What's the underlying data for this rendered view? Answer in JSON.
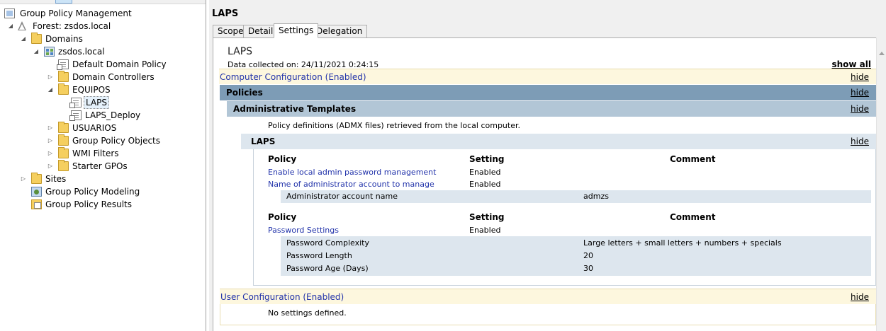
{
  "tree": {
    "nodes": [
      {
        "label": "Group Policy Management",
        "icon": "gpm-console-icon",
        "twisty": ""
      },
      {
        "label": "Forest: zsdos.local",
        "icon": "forest-icon",
        "twisty": "◢"
      },
      {
        "label": "Domains",
        "icon": "folder-icon",
        "twisty": "◢"
      },
      {
        "label": "zsdos.local",
        "icon": "domain-icon",
        "twisty": "◢"
      },
      {
        "label": "Default Domain Policy",
        "icon": "gpo-link-icon",
        "twisty": ""
      },
      {
        "label": "Domain Controllers",
        "icon": "ou-folder-icon",
        "twisty": "▷"
      },
      {
        "label": "EQUIPOS",
        "icon": "ou-folder-icon",
        "twisty": "◢"
      },
      {
        "label": "LAPS",
        "icon": "gpo-link-icon",
        "twisty": ""
      },
      {
        "label": "LAPS_Deploy",
        "icon": "gpo-link-icon",
        "twisty": ""
      },
      {
        "label": "USUARIOS",
        "icon": "ou-folder-icon",
        "twisty": "▷"
      },
      {
        "label": "Group Policy Objects",
        "icon": "folder-icon",
        "twisty": "▷"
      },
      {
        "label": "WMI Filters",
        "icon": "folder-icon",
        "twisty": "▷"
      },
      {
        "label": "Starter GPOs",
        "icon": "folder-icon",
        "twisty": "▷"
      },
      {
        "label": "Sites",
        "icon": "sites-folder-icon",
        "twisty": "▷"
      },
      {
        "label": "Group Policy Modeling",
        "icon": "modeling-icon",
        "twisty": ""
      },
      {
        "label": "Group Policy Results",
        "icon": "results-icon",
        "twisty": ""
      }
    ]
  },
  "main": {
    "title": "LAPS",
    "tabs": [
      "Scope",
      "Details",
      "Settings",
      "Delegation"
    ],
    "active_tab": "Settings"
  },
  "report": {
    "title": "LAPS",
    "collected": "Data collected on: 24/11/2021 0:24:15",
    "show_all": "show all",
    "hide": "hide",
    "computer_config": "Computer Configuration (Enabled)",
    "policies": "Policies",
    "admin_templates": "Administrative Templates",
    "admx_note": "Policy definitions (ADMX files) retrieved from the local computer.",
    "laps_section": "LAPS",
    "col_policy": "Policy",
    "col_setting": "Setting",
    "col_comment": "Comment",
    "table1": [
      {
        "policy": "Enable local admin password management",
        "setting": "Enabled"
      },
      {
        "policy": "Name of administrator account to manage",
        "setting": "Enabled"
      }
    ],
    "table1_sub": [
      {
        "name": "Administrator account name",
        "value": "admzs"
      }
    ],
    "table2": [
      {
        "policy": "Password Settings",
        "setting": "Enabled"
      }
    ],
    "table2_sub": [
      {
        "name": "Password Complexity",
        "value": "Large letters + small letters + numbers + specials"
      },
      {
        "name": "Password Length",
        "value": "20"
      },
      {
        "name": "Password Age (Days)",
        "value": "30"
      }
    ],
    "user_config": "User Configuration (Enabled)",
    "no_settings": "No settings defined."
  },
  "colors": {
    "link": "#2233aa",
    "policies_band": "#7d9cb6",
    "admin_band": "#b2c6d6",
    "laps_band": "#dde6ee",
    "config_band": "#fdf7de"
  }
}
